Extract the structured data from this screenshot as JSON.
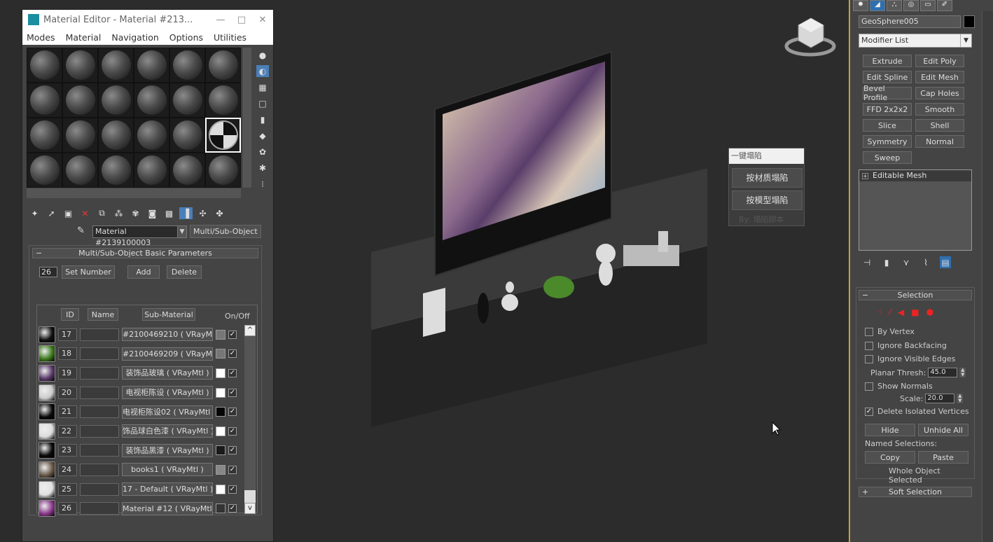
{
  "material_editor": {
    "title": "Material Editor - Material #213...",
    "window_buttons": {
      "minimize": "—",
      "maximize": "□",
      "close": "✕"
    },
    "menus": [
      "Modes",
      "Material",
      "Navigation",
      "Options",
      "Utilities"
    ],
    "material_name": "Material #2139100003",
    "material_type": "Multi/Sub-Object",
    "rollout_title": "Multi/Sub-Object Basic Parameters",
    "rollout_toggle": "−",
    "set_number_value": "26",
    "set_number_label": "Set Number",
    "add_label": "Add",
    "delete_label": "Delete",
    "columns": {
      "id": "ID",
      "name": "Name",
      "sub_material": "Sub-Material",
      "on_off": "On/Off"
    },
    "check_mark": "✓",
    "scroll_up": "^",
    "scroll_down": "v",
    "rows": [
      {
        "id": "17",
        "material": "#2100469210 ( VRayMtl )",
        "swatch": "#111111",
        "color": "#777777"
      },
      {
        "id": "18",
        "material": "#2100469209 ( VRayMtl )",
        "swatch": "#3e7a1e",
        "color": "#777777"
      },
      {
        "id": "19",
        "material": "装饰品玻璃 ( VRayMtl )",
        "swatch": "#5a3a6a",
        "color": "#ffffff"
      },
      {
        "id": "20",
        "material": "电视柜陈设 ( VRayMtl )",
        "swatch": "#cccccc",
        "color": "#ffffff"
      },
      {
        "id": "21",
        "material": "电视柜陈设02 ( VRayMtl )",
        "swatch": "#0a0a0a",
        "color": "#050505"
      },
      {
        "id": "22",
        "material": "饰品球白色漆 ( VRayMtl )",
        "swatch": "#dddddd",
        "color": "#ffffff"
      },
      {
        "id": "23",
        "material": "装饰品黑漆 ( VRayMtl )",
        "swatch": "#0a0a0a",
        "color": "#1a1a1a"
      },
      {
        "id": "24",
        "material": "books1 ( VRayMtl )",
        "swatch": "#6a5a4a",
        "color": "#888888"
      },
      {
        "id": "25",
        "material": "17 - Default ( VRayMtl )",
        "swatch": "#e0e0e0",
        "color": "#ffffff"
      },
      {
        "id": "26",
        "material": "Material #12 ( VRayMtl )",
        "swatch": "#8a3a8a",
        "color": "#333333"
      }
    ]
  },
  "popup": {
    "title": "一键塌陷",
    "btn_by_material": "按材质塌陷",
    "btn_by_model": "按模型塌陷",
    "credit": "By: 塌陷脚本"
  },
  "command_panel": {
    "object_name": "GeoSphere005",
    "modifier_list": "Modifier List",
    "modifier_buttons": [
      "Extrude",
      "Edit Poly",
      "Edit Spline",
      "Edit Mesh",
      "Bevel Profile",
      "Cap Holes",
      "FFD 2x2x2",
      "Smooth",
      "Slice",
      "Shell",
      "Symmetry",
      "Normal",
      "Sweep"
    ],
    "stack_expand": "+",
    "stack_item": "Editable Mesh",
    "selection_title": "Selection",
    "by_vertex": "By Vertex",
    "ignore_backfacing": "Ignore Backfacing",
    "ignore_visible_edges": "Ignore Visible Edges",
    "planar_thresh_label": "Planar Thresh:",
    "planar_thresh_value": "45.0",
    "show_normals": "Show Normals",
    "scale_label": "Scale:",
    "scale_value": "20.0",
    "delete_isolated": "Delete Isolated Vertices",
    "hide_label": "Hide",
    "unhide_all_label": "Unhide All",
    "named_selections_label": "Named Selections:",
    "copy_label": "Copy",
    "paste_label": "Paste",
    "status": "Whole Object Selected",
    "soft_selection_title": "Soft Selection",
    "soft_toggle": "+",
    "selection_toggle": "−"
  }
}
